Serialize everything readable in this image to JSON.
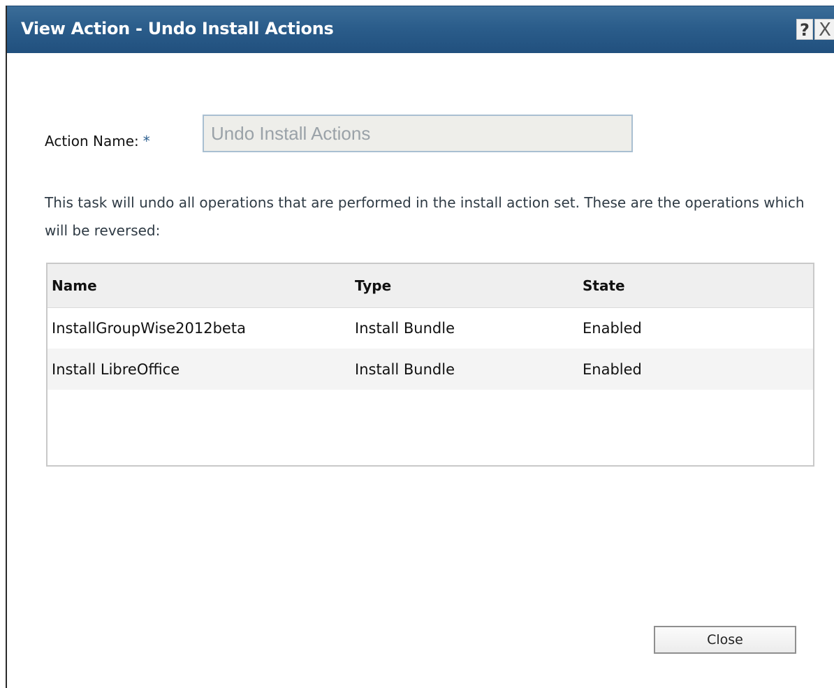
{
  "dialog": {
    "title": "View Action - Undo Install Actions",
    "help_label": "?",
    "close_x_label": "X"
  },
  "form": {
    "action_name_label": "Action Name:",
    "required_marker": "*",
    "action_name_value": "Undo Install Actions"
  },
  "description": "This task will undo all operations that are performed in the install action set. These are the operations which will be reversed:",
  "table": {
    "columns": [
      "Name",
      "Type",
      "State"
    ],
    "rows": [
      {
        "name": "InstallGroupWise2012beta",
        "type": "Install Bundle",
        "state": "Enabled"
      },
      {
        "name": "Install LibreOffice",
        "type": "Install Bundle",
        "state": "Enabled"
      }
    ]
  },
  "footer": {
    "close_label": "Close"
  },
  "colors": {
    "titlebar": "#2b5d8b",
    "required_marker": "#2d5f8f",
    "input_border": "#a9bfd1"
  }
}
